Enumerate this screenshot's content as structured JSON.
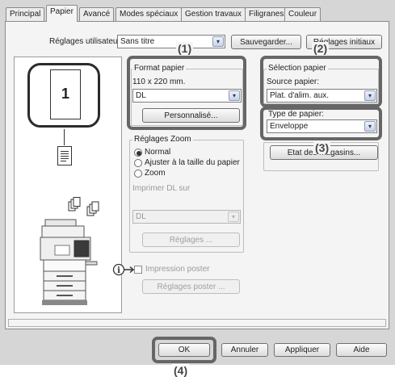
{
  "tabs": [
    {
      "label": "Principal"
    },
    {
      "label": "Papier"
    },
    {
      "label": "Avancé"
    },
    {
      "label": "Modes spéciaux"
    },
    {
      "label": "Gestion travaux"
    },
    {
      "label": "Filigranes"
    },
    {
      "label": "Couleur"
    }
  ],
  "user_settings": {
    "label": "Réglages utilisateur:",
    "value": "Sans titre",
    "save_button": "Sauvegarder...",
    "initial_button": "Réglages initiaux"
  },
  "preview": {
    "page_number": "1"
  },
  "paper_size": {
    "legend": "Format papier",
    "size_text": "110 x 220 mm.",
    "value": "DL",
    "custom_button": "Personnalisé..."
  },
  "zoom": {
    "legend": "Réglages Zoom",
    "options": [
      {
        "label": "Normal",
        "selected": true
      },
      {
        "label": "Ajuster à la taille du papier",
        "selected": false
      },
      {
        "label": "Zoom",
        "selected": false
      }
    ],
    "print_on_label": "Imprimer DL sur",
    "print_on_value": "DL",
    "settings_button": "Réglages ..."
  },
  "poster": {
    "checkbox_label": "Impression poster",
    "settings_button": "Réglages poster ..."
  },
  "paper_selection": {
    "legend": "Sélection papier",
    "source_label": "Source papier:",
    "source_value": "Plat. d'alim. aux."
  },
  "paper_type": {
    "label": "Type de papier:",
    "value": "Enveloppe",
    "trays_button": "Etat des magasins..."
  },
  "footer": {
    "ok": "OK",
    "cancel": "Annuler",
    "apply": "Appliquer",
    "help": "Aide"
  },
  "callouts": {
    "c1": "(1)",
    "c2": "(2)",
    "c3": "(3)",
    "c4": "(4)"
  },
  "icons": {
    "dropdown": "▾",
    "info": "i"
  },
  "colors": {
    "highlight": "#666666",
    "dialog_bg": "#d6d6d6",
    "panel_bg": "#f4f4f4"
  }
}
